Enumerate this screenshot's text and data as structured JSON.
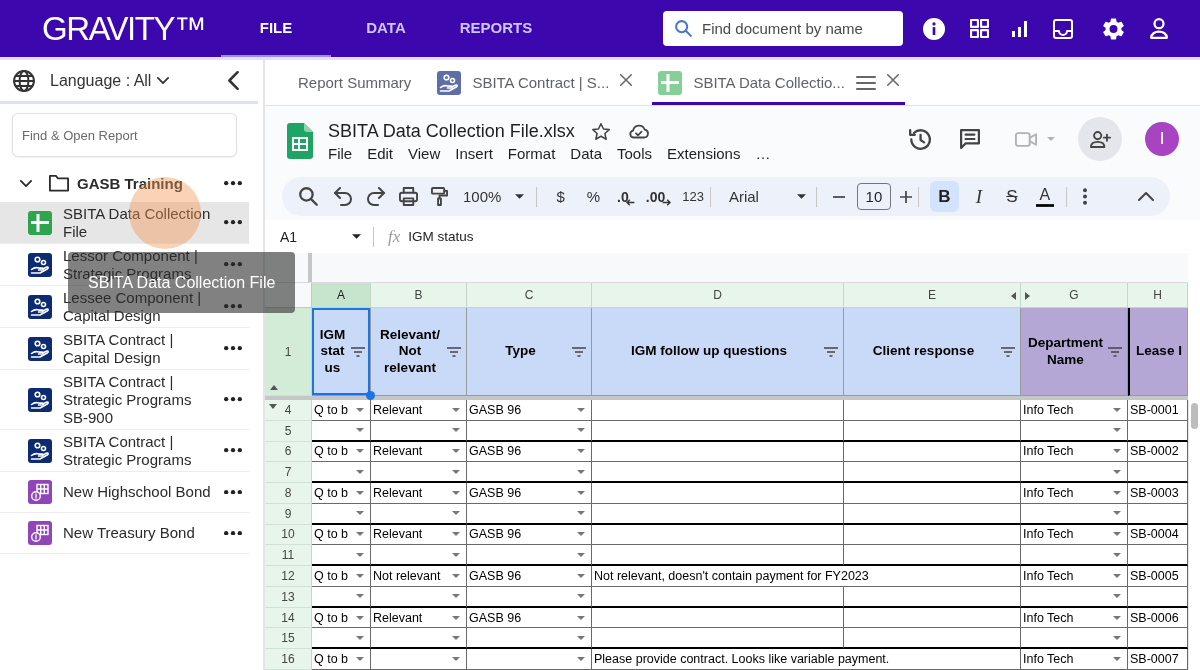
{
  "top_bar": {
    "logo": "GRAVITY™",
    "nav": [
      {
        "label": "FILE",
        "selected": true
      },
      {
        "label": "DATA",
        "selected": false
      },
      {
        "label": "REPORTS",
        "selected": false
      }
    ],
    "search": {
      "placeholder": "Find document by name"
    }
  },
  "sidebar": {
    "language": "Language : All",
    "search": {
      "placeholder": "Find & Open Report"
    },
    "tree": [
      {
        "label": "GASB Training",
        "kind": "folder",
        "expanded": true,
        "selected": false,
        "children": [
          {
            "label": "SBITA Data Collection File",
            "kind": "sheet",
            "selected": true
          },
          {
            "label": "Lessor Component | Strategic Programs",
            "kind": "contract",
            "selected": false
          },
          {
            "label": "Lessee Component | Capital Design",
            "kind": "contract",
            "selected": false
          },
          {
            "label": "SBITA Contract | Capital Design",
            "kind": "contract",
            "selected": false
          },
          {
            "label": "SBITA Contract | Strategic Programs SB-900",
            "kind": "contract",
            "selected": false
          },
          {
            "label": "SBITA Contract | Strategic Programs",
            "kind": "contract",
            "selected": false
          },
          {
            "label": "New Highschool Bond",
            "kind": "bond",
            "selected": false
          },
          {
            "label": "New Treasury Bond",
            "kind": "bond",
            "selected": false
          }
        ]
      }
    ],
    "tooltip": "SBITA Data Collection File"
  },
  "tabs": [
    {
      "label": "Report Summary",
      "kind": "summary",
      "selected": false,
      "closable": false,
      "menu": false
    },
    {
      "label": "SBITA Contract | S...",
      "kind": "contract",
      "selected": false,
      "closable": true,
      "menu": false
    },
    {
      "label": "SBITA Data Collectio...",
      "kind": "sheet",
      "selected": true,
      "closable": true,
      "menu": true
    }
  ],
  "document": {
    "title": "SBITA Data Collection File.xlsx",
    "menus": [
      "File",
      "Edit",
      "View",
      "Insert",
      "Format",
      "Data",
      "Tools",
      "Extensions"
    ],
    "menu_overflow": "…",
    "avatar": "I"
  },
  "toolbar": {
    "zoom": "100%",
    "currency": "$",
    "percent": "%",
    "decrease_decimals": ".0",
    "increase_decimals": ".00",
    "number_format": "123",
    "font": "Arial",
    "font_size": "10",
    "formats": [
      {
        "label": "B",
        "kind": "bold",
        "on": true
      },
      {
        "label": "I",
        "kind": "italic",
        "on": false
      },
      {
        "label": "S",
        "kind": "strikethrough",
        "on": false
      },
      {
        "label": "A",
        "kind": "text_color",
        "on": false
      }
    ]
  },
  "formula_bar": {
    "cell": "A1",
    "function_label": "fx",
    "value": "IGM status"
  },
  "sheet": {
    "columns": [
      {
        "letter": "A",
        "selected": true,
        "dropdown": true,
        "gap_after": false
      },
      {
        "letter": "B",
        "selected": false,
        "dropdown": true,
        "gap_after": false
      },
      {
        "letter": "C",
        "selected": false,
        "dropdown": true,
        "gap_after": false
      },
      {
        "letter": "D",
        "selected": false,
        "dropdown": false,
        "gap_after": false
      },
      {
        "letter": "E",
        "selected": false,
        "dropdown": false,
        "gap_after": true
      },
      {
        "letter": "G",
        "selected": false,
        "dropdown": true,
        "gap_after": false
      },
      {
        "letter": "H",
        "selected": false,
        "dropdown": false,
        "gap_after": false
      }
    ],
    "header_row": {
      "number": "1",
      "gap_after": true,
      "cells": [
        {
          "text": "IGM status",
          "color": "#c9daf8",
          "selected": true,
          "filter": true,
          "thick_left": false
        },
        {
          "text": "Relevant/ Not relevant",
          "color": "#c9daf8",
          "selected": false,
          "filter": true,
          "thick_left": false
        },
        {
          "text": "Type",
          "color": "#c9daf8",
          "selected": false,
          "filter": true,
          "thick_left": false
        },
        {
          "text": "IGM follow up questions",
          "color": "#c9daf8",
          "selected": false,
          "filter": true,
          "thick_left": false
        },
        {
          "text": "Client response",
          "color": "#c9daf8",
          "selected": false,
          "filter": true,
          "thick_left": false
        },
        {
          "text": "Department Name",
          "color": "#b4a7d6",
          "selected": false,
          "filter": true,
          "thick_left": false
        },
        {
          "text": "Lease I",
          "color": "#b4a7d6",
          "selected": false,
          "filter": false,
          "thick_left": true
        }
      ]
    },
    "rows": [
      {
        "number": "4",
        "thick_bottom": false,
        "cells": {
          "igm_status": "Q to b",
          "relevant": "Relevant",
          "type": "GASB 96",
          "department": "Info Tech",
          "lease": "SB-0001"
        }
      },
      {
        "number": "5",
        "thick_bottom": true
      },
      {
        "number": "6",
        "thick_bottom": false,
        "cells": {
          "igm_status": "Q to b",
          "relevant": "Relevant",
          "type": "GASB 96",
          "department": "Info Tech",
          "lease": "SB-0002"
        }
      },
      {
        "number": "7",
        "thick_bottom": true
      },
      {
        "number": "8",
        "thick_bottom": false,
        "cells": {
          "igm_status": "Q to b",
          "relevant": "Relevant",
          "type": "GASB 96",
          "department": "Info Tech",
          "lease": "SB-0003"
        }
      },
      {
        "number": "9",
        "thick_bottom": true
      },
      {
        "number": "10",
        "thick_bottom": false,
        "cells": {
          "igm_status": "Q to b",
          "relevant": "Relevant",
          "type": "GASB 96",
          "department": "Info Tech",
          "lease": "SB-0004"
        }
      },
      {
        "number": "11",
        "thick_bottom": true
      },
      {
        "number": "12",
        "thick_bottom": false,
        "cells": {
          "igm_status": "Q to b",
          "relevant": "Not relevant",
          "type": "GASB 96",
          "follow_up": "Not relevant, doesn't contain payment for FY2023",
          "department": "Info Tech",
          "lease": "SB-0005"
        }
      },
      {
        "number": "13",
        "thick_bottom": true
      },
      {
        "number": "14",
        "thick_bottom": false,
        "cells": {
          "igm_status": "Q to b",
          "relevant": "Relevant",
          "type": "GASB 96",
          "department": "Info Tech",
          "lease": "SB-0006"
        }
      },
      {
        "number": "15",
        "thick_bottom": true
      },
      {
        "number": "16",
        "thick_bottom": false,
        "cells": {
          "igm_status": "Q to b",
          "follow_up": "Please provide contract. Looks like variable payment.",
          "department": "Info Tech",
          "lease": "SB-0007"
        }
      }
    ]
  }
}
